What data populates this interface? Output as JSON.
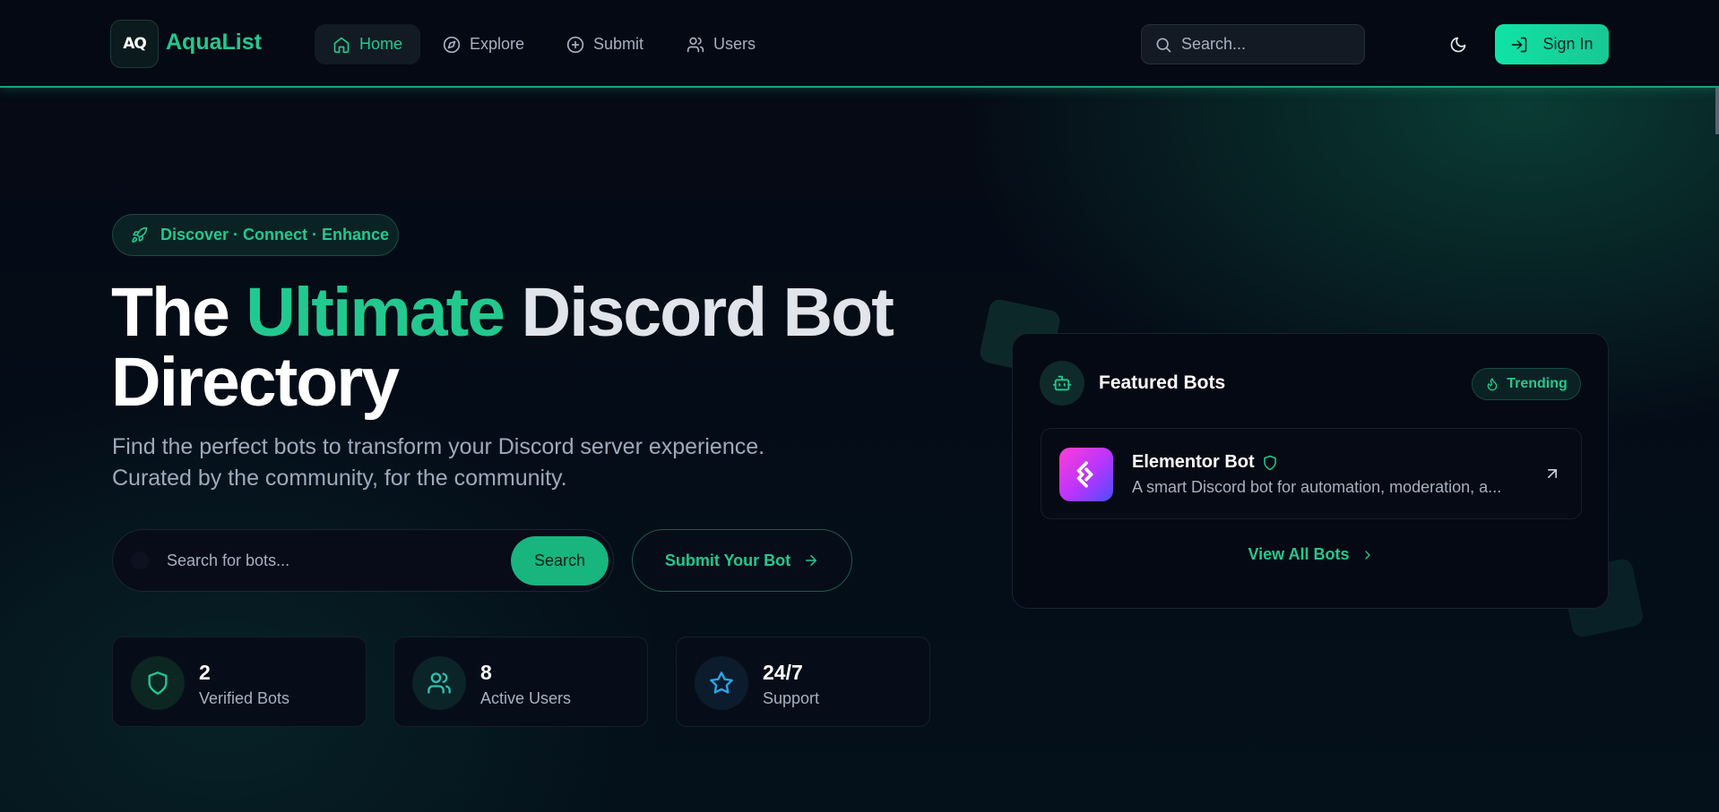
{
  "colors": {
    "accent": "#22c98e",
    "background": "#050914",
    "button": "#10e3a6"
  },
  "brand": {
    "logo_mark": "AQ",
    "name": "AquaList"
  },
  "nav": {
    "items": [
      {
        "label": "Home",
        "icon": "home-icon",
        "active": true
      },
      {
        "label": "Explore",
        "icon": "compass-icon",
        "active": false
      },
      {
        "label": "Submit",
        "icon": "plus-circle-icon",
        "active": false
      },
      {
        "label": "Users",
        "icon": "users-icon",
        "active": false
      }
    ],
    "search_placeholder": "Search...",
    "theme_icon": "moon-icon",
    "signin_label": "Sign In"
  },
  "hero": {
    "pill": "Discover · Connect · Enhance",
    "title_part1": "The ",
    "title_accent": "Ultimate",
    "title_part2": " Discord Bot",
    "title_line2": "Directory",
    "subtitle": "Find the perfect bots to transform your Discord server experience. Curated by the community, for the community.",
    "search_placeholder": "Search for bots...",
    "search_button": "Search",
    "submit_button": "Submit Your Bot"
  },
  "stats": [
    {
      "value": "2",
      "label": "Verified Bots",
      "icon": "shield-icon"
    },
    {
      "value": "8",
      "label": "Active Users",
      "icon": "users-icon"
    },
    {
      "value": "24/7",
      "label": "Support",
      "icon": "star-icon"
    }
  ],
  "featured": {
    "title": "Featured Bots",
    "badge": "Trending",
    "bots": [
      {
        "name": "Elementor Bot",
        "verified": true,
        "description": "A smart Discord bot for automation, moderation, a..."
      }
    ],
    "view_all": "View All Bots"
  }
}
